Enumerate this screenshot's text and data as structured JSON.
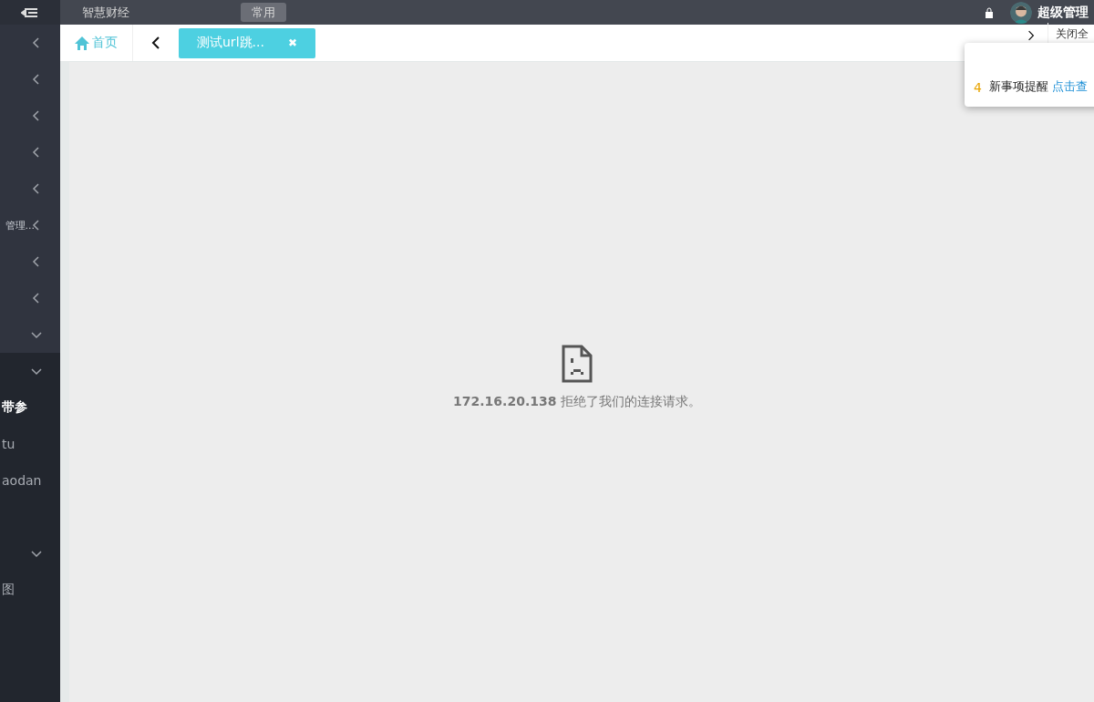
{
  "topbar": {
    "items": [
      {
        "label": "智慧财经",
        "selected": false
      },
      {
        "label": "常用",
        "selected": true
      }
    ],
    "user": "超级管理"
  },
  "sidebar": {
    "groups": [
      {
        "expanded": false
      },
      {
        "expanded": false
      },
      {
        "expanded": false
      },
      {
        "expanded": false
      },
      {
        "expanded": false
      },
      {
        "label": "管理...",
        "expanded": false
      },
      {
        "expanded": false
      },
      {
        "expanded": false
      },
      {
        "expanded": true
      },
      {
        "expanded": true,
        "children": [
          {
            "label": "带参",
            "selected": true
          },
          {
            "label": "tu",
            "selected": false
          },
          {
            "label": "aodan",
            "selected": false
          }
        ]
      },
      {
        "expanded": true,
        "children": [
          {
            "label": "图",
            "selected": false
          }
        ]
      }
    ]
  },
  "tabs": {
    "home": "首页",
    "items": [
      {
        "label": "测试url跳...",
        "selected": true,
        "close": "✖"
      }
    ],
    "close_all": "关闭全"
  },
  "notice": {
    "count": "4",
    "text": "新事项提醒",
    "link": "点击查"
  },
  "error": {
    "message": "**172.16.20.138** 拒绝了我们的连接请求。"
  }
}
